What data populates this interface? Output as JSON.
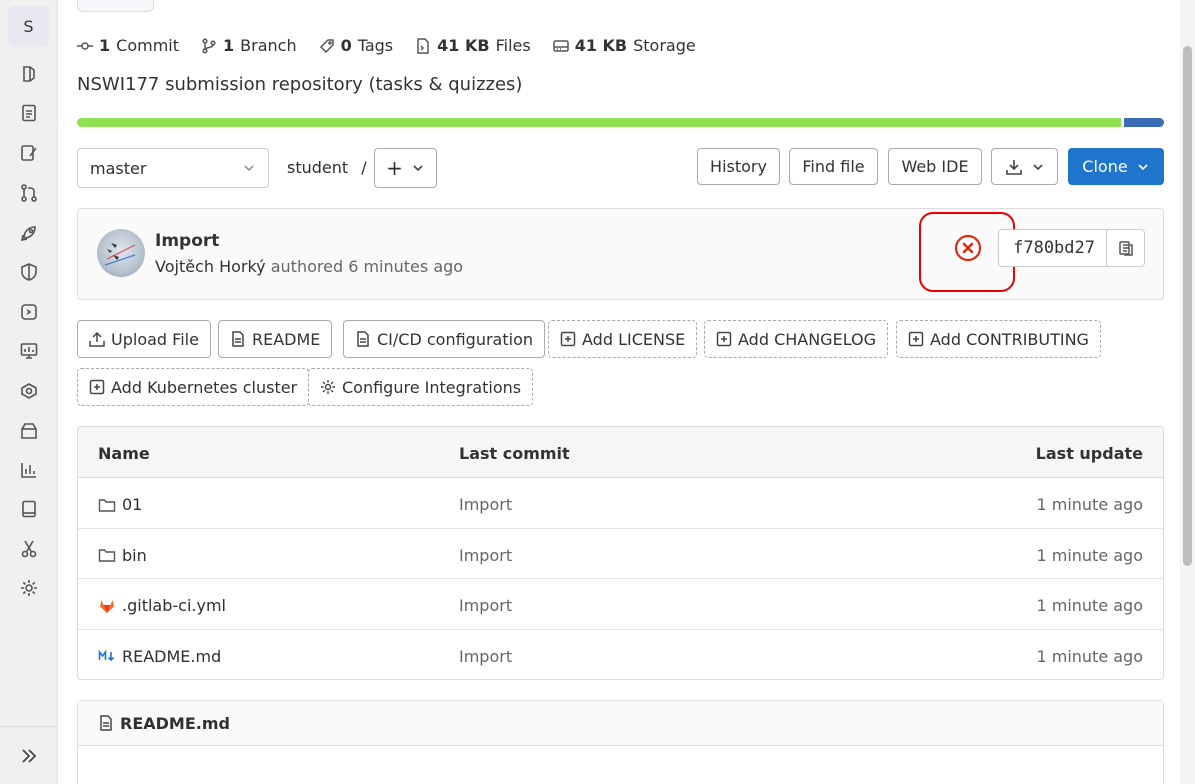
{
  "sidebar": {
    "project_initial": "S",
    "icons": [
      "pin-icon",
      "issues-icon",
      "edit-icon",
      "merge-request-icon",
      "rocket-icon",
      "shield-icon",
      "deploy-icon",
      "monitor-icon",
      "cloud-icon",
      "package-icon",
      "analytics-icon",
      "wiki-icon",
      "snippets-icon",
      "settings-icon"
    ],
    "expand_icon": "chevron-double-right-icon"
  },
  "stats": {
    "commits_count": "1",
    "commits_label": "Commit",
    "branches_count": "1",
    "branches_label": "Branch",
    "tags_count": "0",
    "tags_label": "Tags",
    "files_size": "41 KB",
    "files_label": "Files",
    "storage_size": "41 KB",
    "storage_label": "Storage"
  },
  "description": "NSWI177 submission repository (tasks & quizzes)",
  "language_bar": {
    "colors": [
      "#8fe153",
      "#3b6bb3"
    ],
    "shares": [
      0.96,
      0.04
    ]
  },
  "controls": {
    "branch": "master",
    "path_segment": "student",
    "path_separator": "/",
    "add_symbol": "+",
    "history": "History",
    "find_file": "Find file",
    "web_ide": "Web IDE",
    "clone": "Clone"
  },
  "commit": {
    "title": "Import",
    "author": "Vojtěch Horký",
    "meta": "authored 6 minutes ago",
    "sha": "f780bd27",
    "status": "failed",
    "status_color": "#dd2b0e"
  },
  "actions": {
    "upload": "Upload File",
    "readme": "README",
    "cicd": "CI/CD configuration",
    "license": "Add LICENSE",
    "changelog": "Add CHANGELOG",
    "contributing": "Add CONTRIBUTING",
    "kubernetes": "Add Kubernetes cluster",
    "integrations": "Configure Integrations"
  },
  "table": {
    "headers": {
      "name": "Name",
      "last_commit": "Last commit",
      "last_update": "Last update"
    },
    "rows": [
      {
        "name": "01",
        "type": "folder",
        "commit": "Import",
        "updated": "1 minute ago"
      },
      {
        "name": "bin",
        "type": "folder",
        "commit": "Import",
        "updated": "1 minute ago"
      },
      {
        "name": ".gitlab-ci.yml",
        "type": "gitlab",
        "commit": "Import",
        "updated": "1 minute ago"
      },
      {
        "name": "README.md",
        "type": "markdown",
        "commit": "Import",
        "updated": "1 minute ago"
      }
    ]
  },
  "readme": {
    "title": "README.md"
  }
}
